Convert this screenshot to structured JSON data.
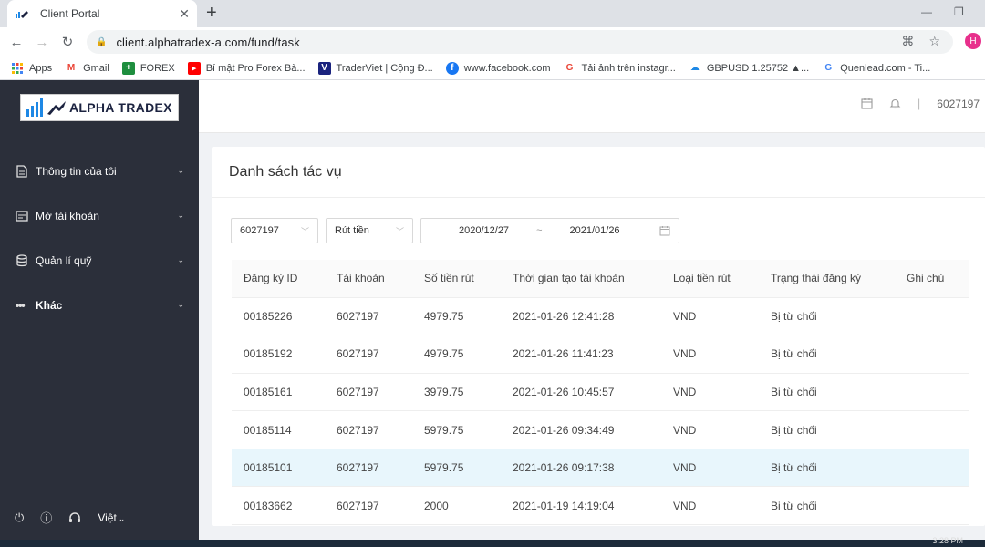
{
  "browser": {
    "tab_title": "Client Portal",
    "tab_close": "✕",
    "new_tab": "+",
    "url": "client.alphatradex-a.com/fund/task",
    "profile_initial": "H",
    "bookmarks": [
      {
        "label": "Apps",
        "icon": "apps-icon",
        "color": "#4285f4"
      },
      {
        "label": "Gmail",
        "icon": "gmail-icon",
        "color": "#ea4335"
      },
      {
        "label": "FOREX",
        "icon": "forex-icon",
        "color": "#1e8e3e"
      },
      {
        "label": "Bí mật Pro Forex Bà...",
        "icon": "youtube-icon",
        "color": "#ff0000"
      },
      {
        "label": "TraderViet | Cộng Đ...",
        "icon": "traderviet-icon",
        "color": "#1a237e"
      },
      {
        "label": "www.facebook.com",
        "icon": "facebook-icon",
        "color": "#1877f2"
      },
      {
        "label": "Tải ảnh trên instagr...",
        "icon": "google-icon",
        "color": "#ea4335"
      },
      {
        "label": "GBPUSD 1.25752 ▲...",
        "icon": "cloud-icon",
        "color": "#1e88e5"
      },
      {
        "label": "Quenlead.com - Ti...",
        "icon": "google-icon",
        "color": "#4285f4"
      }
    ]
  },
  "sidebar": {
    "logo_text": "ALPHA TRADEX",
    "menu": [
      {
        "label": "Thông tin của tôi",
        "icon": "document-icon"
      },
      {
        "label": "Mở tài khoản",
        "icon": "card-icon"
      },
      {
        "label": "Quản lí quỹ",
        "icon": "database-icon"
      },
      {
        "label": "Khác",
        "icon": "more-icon"
      }
    ],
    "language": "Việt"
  },
  "header": {
    "account": "6027197"
  },
  "page": {
    "title": "Danh sách tác vụ",
    "filters": {
      "account": "6027197",
      "type": "Rút tiền",
      "date_from": "2020/12/27",
      "date_sep": "~",
      "date_to": "2021/01/26"
    },
    "table": {
      "columns": [
        "Đăng ký ID",
        "Tài khoản",
        "Số tiền rút",
        "Thời gian tạo tài khoản",
        "Loại tiền rút",
        "Trạng thái đăng ký",
        "Ghi chú"
      ],
      "rows": [
        [
          "00185226",
          "6027197",
          "4979.75",
          "2021-01-26 12:41:28",
          "VND",
          "Bị từ chối",
          ""
        ],
        [
          "00185192",
          "6027197",
          "4979.75",
          "2021-01-26 11:41:23",
          "VND",
          "Bị từ chối",
          ""
        ],
        [
          "00185161",
          "6027197",
          "3979.75",
          "2021-01-26 10:45:57",
          "VND",
          "Bị từ chối",
          ""
        ],
        [
          "00185114",
          "6027197",
          "5979.75",
          "2021-01-26 09:34:49",
          "VND",
          "Bị từ chối",
          ""
        ],
        [
          "00185101",
          "6027197",
          "5979.75",
          "2021-01-26 09:17:38",
          "VND",
          "Bị từ chối",
          ""
        ],
        [
          "00183662",
          "6027197",
          "2000",
          "2021-01-19 14:19:04",
          "VND",
          "Bị từ chối",
          ""
        ]
      ],
      "highlighted_row": 4
    }
  },
  "taskbar": {
    "clock": "3:28 PM"
  }
}
